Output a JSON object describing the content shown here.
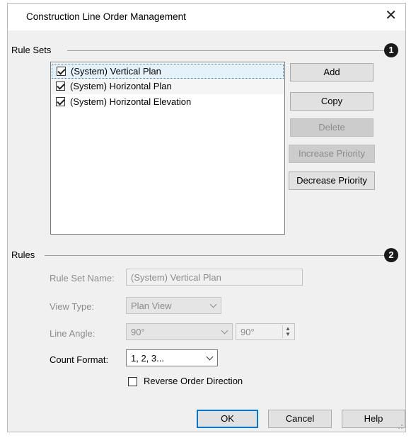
{
  "window": {
    "title": "Construction Line Order Management",
    "close_glyph": "✕"
  },
  "rule_sets": {
    "label": "Rule Sets",
    "badge": "1",
    "items": [
      {
        "label": "(System) Vertical Plan",
        "checked": true,
        "selected": true
      },
      {
        "label": "(System) Horizontal Plan",
        "checked": true,
        "selected": false
      },
      {
        "label": "(System) Horizontal Elevation",
        "checked": true,
        "selected": false
      }
    ],
    "buttons": {
      "add": "Add",
      "copy": "Copy",
      "delete": "Delete",
      "increase_priority": "Increase Priority",
      "decrease_priority": "Decrease Priority"
    }
  },
  "rules": {
    "label": "Rules",
    "badge": "2",
    "rule_set_name_label": "Rule Set Name:",
    "rule_set_name_value": "(System) Vertical Plan",
    "view_type_label": "View Type:",
    "view_type_value": "Plan View",
    "line_angle_label": "Line Angle:",
    "line_angle_value": "90°",
    "line_angle_spin_value": "90°",
    "count_format_label": "Count Format:",
    "count_format_value": "1, 2, 3...",
    "reverse_order_label": "Reverse Order Direction",
    "reverse_order_checked": false
  },
  "footer": {
    "ok": "OK",
    "cancel": "Cancel",
    "help": "Help"
  },
  "colors": {
    "accent": "#0078d7",
    "selection": "#e5f1fb",
    "dialog_bg": "#f0f0f0"
  }
}
